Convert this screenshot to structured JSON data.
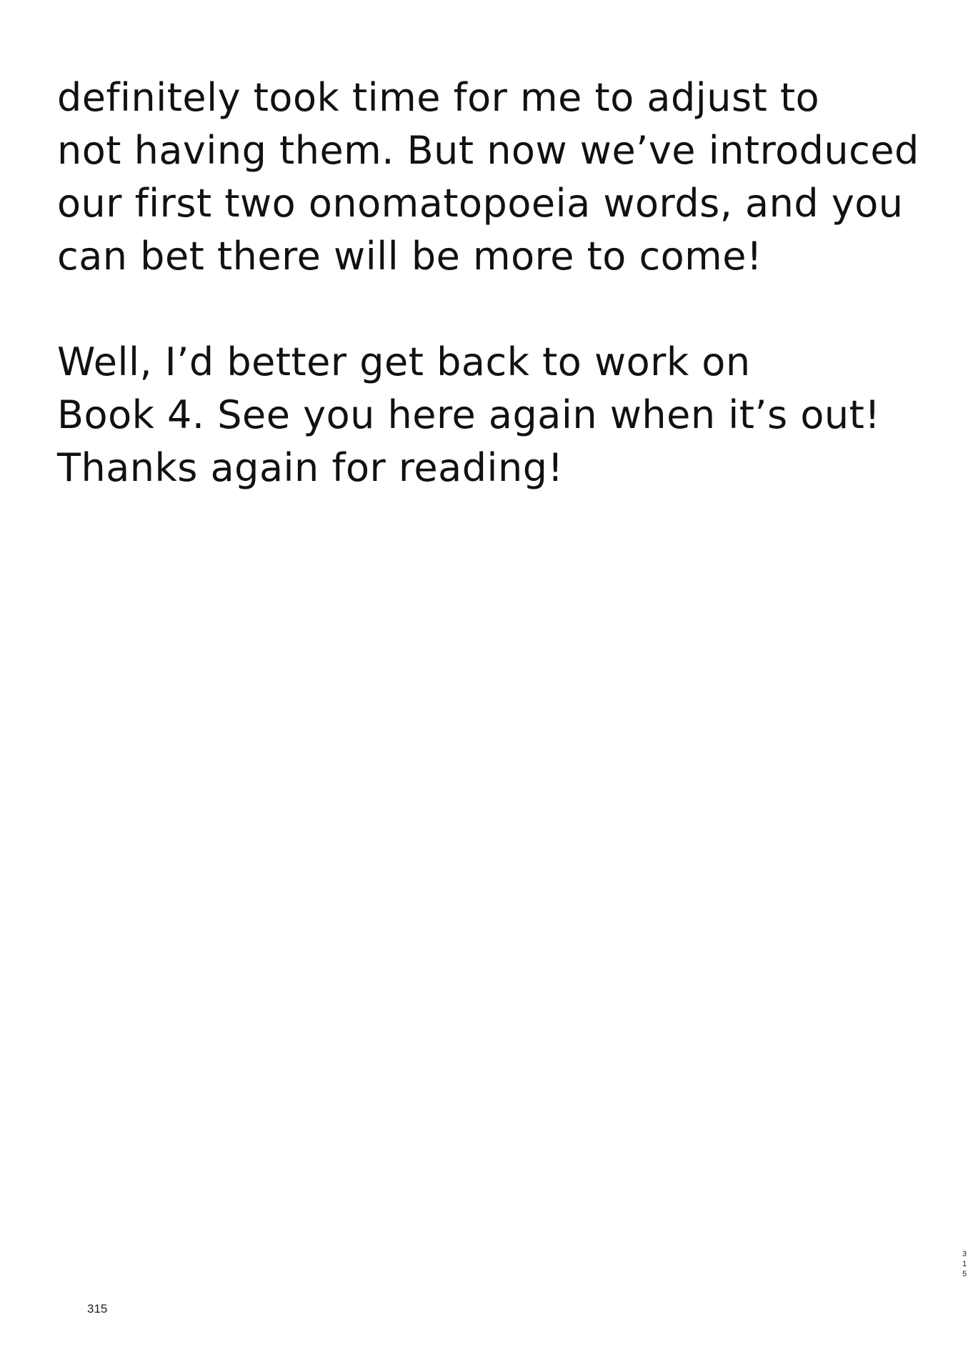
{
  "paragraphs": [
    {
      "lines": [
        "definitely took time for me to adjust to",
        "not having them. But now we’ve introduced",
        "our first two onomatopoeia words, and you",
        "can bet there will be more to come!"
      ]
    },
    {
      "lines": [
        "Well, I’d better get back to work on",
        "Book 4. See you here again when it’s out!",
        "Thanks again for reading!"
      ]
    }
  ],
  "page_number": "315",
  "side_page_number_digits": [
    "3",
    "1",
    "5"
  ]
}
